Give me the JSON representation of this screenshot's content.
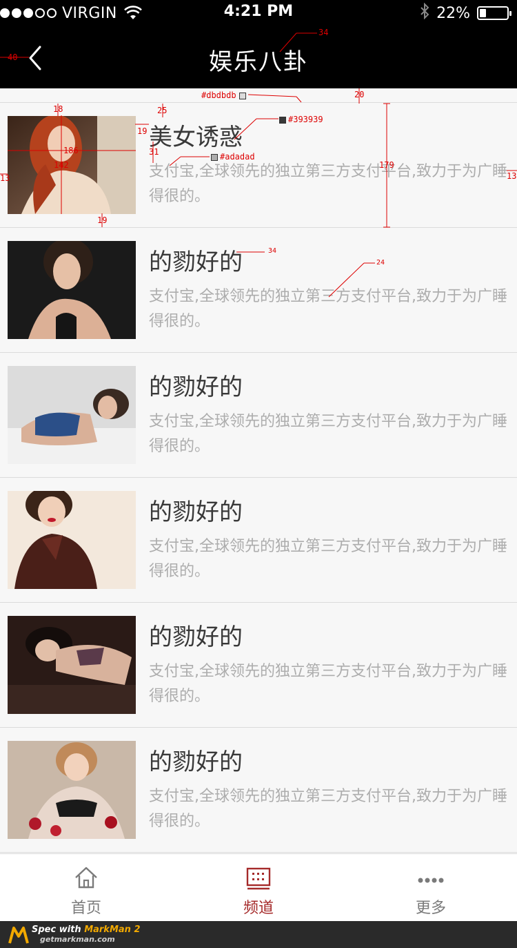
{
  "status_bar": {
    "carrier": "VIRGIN",
    "time": "4:21 PM",
    "battery": "22%",
    "battery_level": 0.22,
    "signal_bars_filled": 3,
    "signal_bars_total": 5
  },
  "nav": {
    "title": "娱乐八卦",
    "back_icon": "chevron-left-icon"
  },
  "list": {
    "items": [
      {
        "title": "美女诱惑",
        "desc": "支付宝,全球领先的独立第三方支付平台,致力于为广睡得很的。"
      },
      {
        "title": "的勠好的",
        "desc": "支付宝,全球领先的独立第三方支付平台,致力于为广睡得很的。"
      },
      {
        "title": "的勠好的",
        "desc": "支付宝,全球领先的独立第三方支付平台,致力于为广睡得很的。"
      },
      {
        "title": "的勠好的",
        "desc": "支付宝,全球领先的独立第三方支付平台,致力于为广睡得很的。"
      },
      {
        "title": "的勠好的",
        "desc": "支付宝,全球领先的独立第三方支付平台,致力于为广睡得很的。"
      },
      {
        "title": "的勠好的",
        "desc": "支付宝,全球领先的独立第三方支付平台,致力于为广睡得很的。"
      }
    ]
  },
  "tabs": [
    {
      "label": "首页",
      "icon": "home-icon",
      "active": false
    },
    {
      "label": "频道",
      "icon": "channel-grid-icon",
      "active": true
    },
    {
      "label": "更多",
      "icon": "more-dots-icon",
      "active": false
    }
  ],
  "colors": {
    "accent": "#a52a2a",
    "divider": "#dbdbdb",
    "title_text": "#393939",
    "desc_text": "#adadad",
    "background": "#f7f7f7",
    "bar": "#000000"
  },
  "annotations": {
    "divider_color": "#dbdbdb",
    "title_color": "#393939",
    "desc_color": "#adadad",
    "nav_title_size": "34",
    "back_margin": "40",
    "item_top_gap": "20",
    "item_height": "179",
    "thumb_top": "18",
    "thumb_width": "186",
    "thumb_height": "142",
    "thumb_bottom": "19",
    "thumb_left": "13",
    "title_top": "25",
    "title_left": "19",
    "desc_top": "31",
    "right_margin": "13",
    "title_size": "34",
    "desc_size": "24"
  },
  "markman": {
    "line1_prefix": "Spec with ",
    "line1_brand": "MarkMan 2",
    "line2": "getmarkman.com"
  }
}
